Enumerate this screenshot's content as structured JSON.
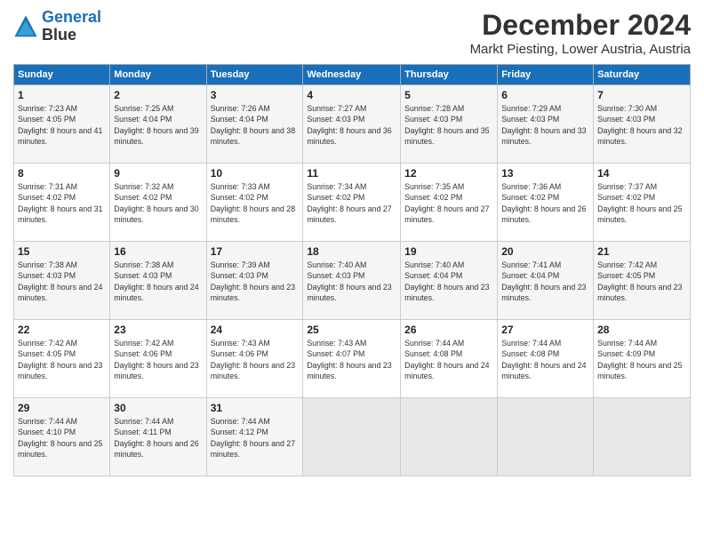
{
  "header": {
    "logo_line1": "General",
    "logo_line2": "Blue",
    "month": "December 2024",
    "location": "Markt Piesting, Lower Austria, Austria"
  },
  "weekdays": [
    "Sunday",
    "Monday",
    "Tuesday",
    "Wednesday",
    "Thursday",
    "Friday",
    "Saturday"
  ],
  "weeks": [
    [
      {
        "day": "1",
        "sunrise": "Sunrise: 7:23 AM",
        "sunset": "Sunset: 4:05 PM",
        "daylight": "Daylight: 8 hours and 41 minutes."
      },
      {
        "day": "2",
        "sunrise": "Sunrise: 7:25 AM",
        "sunset": "Sunset: 4:04 PM",
        "daylight": "Daylight: 8 hours and 39 minutes."
      },
      {
        "day": "3",
        "sunrise": "Sunrise: 7:26 AM",
        "sunset": "Sunset: 4:04 PM",
        "daylight": "Daylight: 8 hours and 38 minutes."
      },
      {
        "day": "4",
        "sunrise": "Sunrise: 7:27 AM",
        "sunset": "Sunset: 4:03 PM",
        "daylight": "Daylight: 8 hours and 36 minutes."
      },
      {
        "day": "5",
        "sunrise": "Sunrise: 7:28 AM",
        "sunset": "Sunset: 4:03 PM",
        "daylight": "Daylight: 8 hours and 35 minutes."
      },
      {
        "day": "6",
        "sunrise": "Sunrise: 7:29 AM",
        "sunset": "Sunset: 4:03 PM",
        "daylight": "Daylight: 8 hours and 33 minutes."
      },
      {
        "day": "7",
        "sunrise": "Sunrise: 7:30 AM",
        "sunset": "Sunset: 4:03 PM",
        "daylight": "Daylight: 8 hours and 32 minutes."
      }
    ],
    [
      {
        "day": "8",
        "sunrise": "Sunrise: 7:31 AM",
        "sunset": "Sunset: 4:02 PM",
        "daylight": "Daylight: 8 hours and 31 minutes."
      },
      {
        "day": "9",
        "sunrise": "Sunrise: 7:32 AM",
        "sunset": "Sunset: 4:02 PM",
        "daylight": "Daylight: 8 hours and 30 minutes."
      },
      {
        "day": "10",
        "sunrise": "Sunrise: 7:33 AM",
        "sunset": "Sunset: 4:02 PM",
        "daylight": "Daylight: 8 hours and 28 minutes."
      },
      {
        "day": "11",
        "sunrise": "Sunrise: 7:34 AM",
        "sunset": "Sunset: 4:02 PM",
        "daylight": "Daylight: 8 hours and 27 minutes."
      },
      {
        "day": "12",
        "sunrise": "Sunrise: 7:35 AM",
        "sunset": "Sunset: 4:02 PM",
        "daylight": "Daylight: 8 hours and 27 minutes."
      },
      {
        "day": "13",
        "sunrise": "Sunrise: 7:36 AM",
        "sunset": "Sunset: 4:02 PM",
        "daylight": "Daylight: 8 hours and 26 minutes."
      },
      {
        "day": "14",
        "sunrise": "Sunrise: 7:37 AM",
        "sunset": "Sunset: 4:02 PM",
        "daylight": "Daylight: 8 hours and 25 minutes."
      }
    ],
    [
      {
        "day": "15",
        "sunrise": "Sunrise: 7:38 AM",
        "sunset": "Sunset: 4:03 PM",
        "daylight": "Daylight: 8 hours and 24 minutes."
      },
      {
        "day": "16",
        "sunrise": "Sunrise: 7:38 AM",
        "sunset": "Sunset: 4:03 PM",
        "daylight": "Daylight: 8 hours and 24 minutes."
      },
      {
        "day": "17",
        "sunrise": "Sunrise: 7:39 AM",
        "sunset": "Sunset: 4:03 PM",
        "daylight": "Daylight: 8 hours and 23 minutes."
      },
      {
        "day": "18",
        "sunrise": "Sunrise: 7:40 AM",
        "sunset": "Sunset: 4:03 PM",
        "daylight": "Daylight: 8 hours and 23 minutes."
      },
      {
        "day": "19",
        "sunrise": "Sunrise: 7:40 AM",
        "sunset": "Sunset: 4:04 PM",
        "daylight": "Daylight: 8 hours and 23 minutes."
      },
      {
        "day": "20",
        "sunrise": "Sunrise: 7:41 AM",
        "sunset": "Sunset: 4:04 PM",
        "daylight": "Daylight: 8 hours and 23 minutes."
      },
      {
        "day": "21",
        "sunrise": "Sunrise: 7:42 AM",
        "sunset": "Sunset: 4:05 PM",
        "daylight": "Daylight: 8 hours and 23 minutes."
      }
    ],
    [
      {
        "day": "22",
        "sunrise": "Sunrise: 7:42 AM",
        "sunset": "Sunset: 4:05 PM",
        "daylight": "Daylight: 8 hours and 23 minutes."
      },
      {
        "day": "23",
        "sunrise": "Sunrise: 7:42 AM",
        "sunset": "Sunset: 4:06 PM",
        "daylight": "Daylight: 8 hours and 23 minutes."
      },
      {
        "day": "24",
        "sunrise": "Sunrise: 7:43 AM",
        "sunset": "Sunset: 4:06 PM",
        "daylight": "Daylight: 8 hours and 23 minutes."
      },
      {
        "day": "25",
        "sunrise": "Sunrise: 7:43 AM",
        "sunset": "Sunset: 4:07 PM",
        "daylight": "Daylight: 8 hours and 23 minutes."
      },
      {
        "day": "26",
        "sunrise": "Sunrise: 7:44 AM",
        "sunset": "Sunset: 4:08 PM",
        "daylight": "Daylight: 8 hours and 24 minutes."
      },
      {
        "day": "27",
        "sunrise": "Sunrise: 7:44 AM",
        "sunset": "Sunset: 4:08 PM",
        "daylight": "Daylight: 8 hours and 24 minutes."
      },
      {
        "day": "28",
        "sunrise": "Sunrise: 7:44 AM",
        "sunset": "Sunset: 4:09 PM",
        "daylight": "Daylight: 8 hours and 25 minutes."
      }
    ],
    [
      {
        "day": "29",
        "sunrise": "Sunrise: 7:44 AM",
        "sunset": "Sunset: 4:10 PM",
        "daylight": "Daylight: 8 hours and 25 minutes."
      },
      {
        "day": "30",
        "sunrise": "Sunrise: 7:44 AM",
        "sunset": "Sunset: 4:11 PM",
        "daylight": "Daylight: 8 hours and 26 minutes."
      },
      {
        "day": "31",
        "sunrise": "Sunrise: 7:44 AM",
        "sunset": "Sunset: 4:12 PM",
        "daylight": "Daylight: 8 hours and 27 minutes."
      },
      null,
      null,
      null,
      null
    ]
  ]
}
